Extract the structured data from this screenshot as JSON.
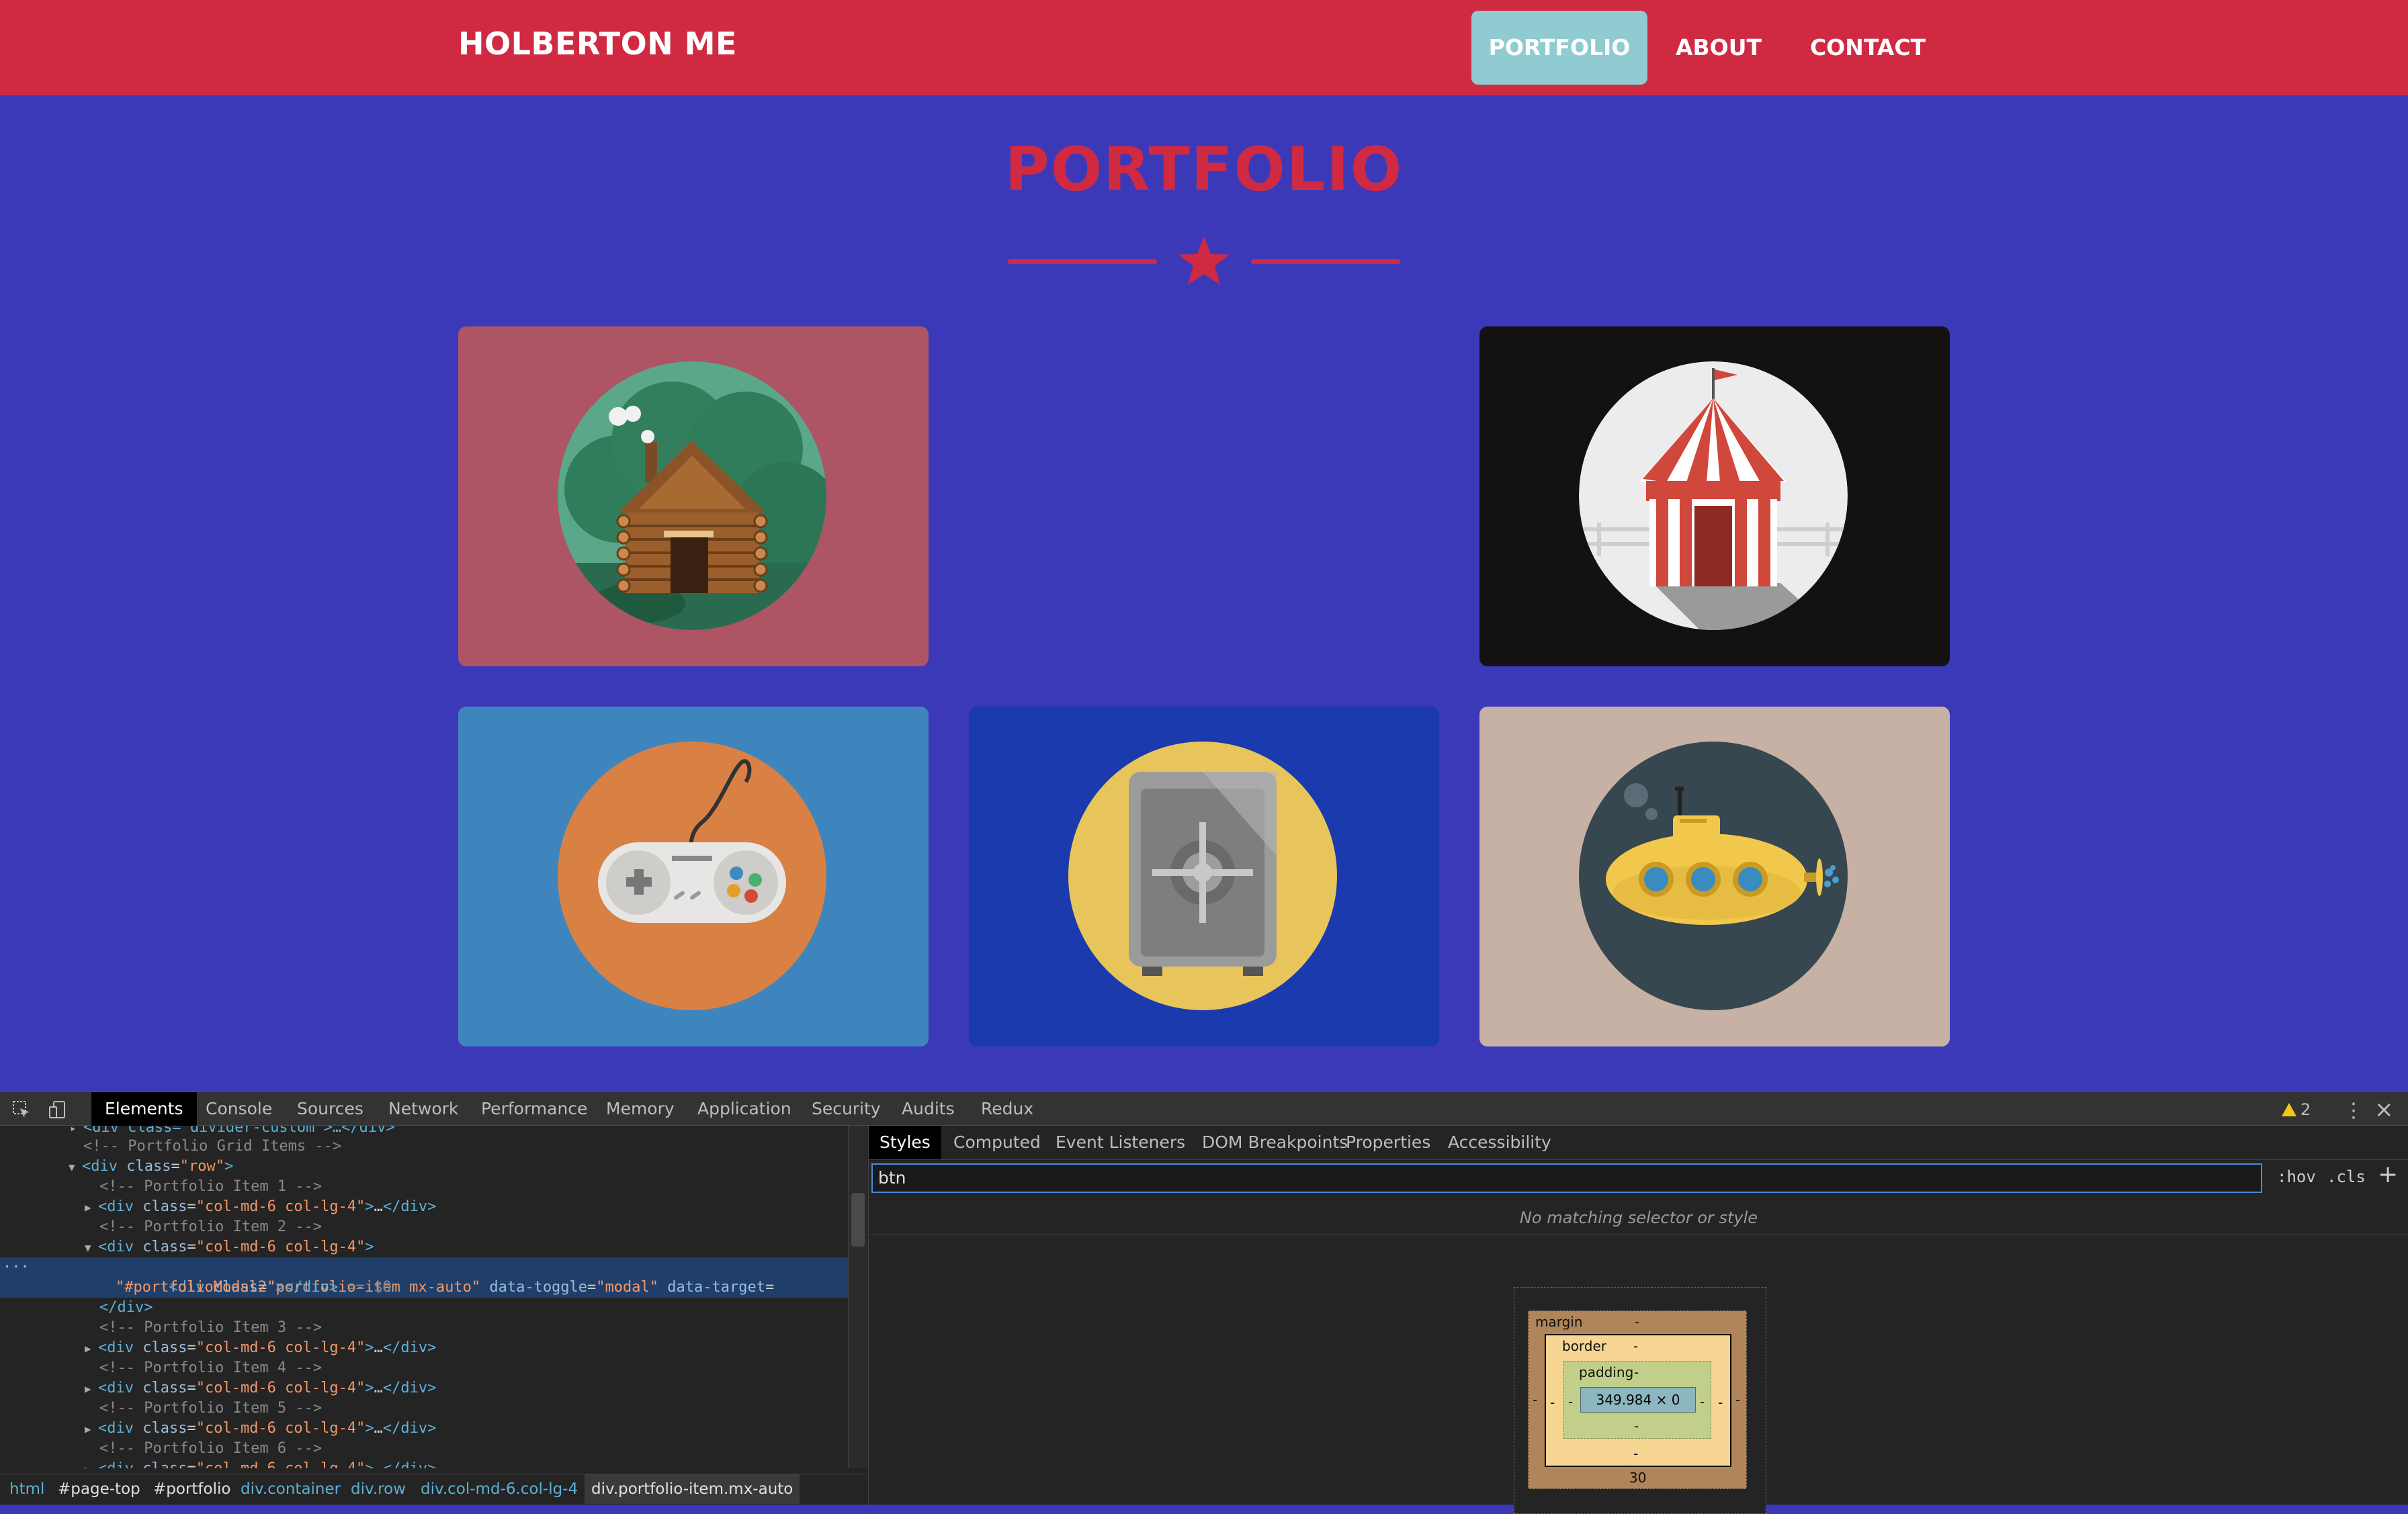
{
  "navbar": {
    "brand": "HOLBERTON ME",
    "links": [
      "PORTFOLIO",
      "ABOUT",
      "CONTACT"
    ],
    "active": "PORTFOLIO"
  },
  "portfolio": {
    "title": "PORTFOLIO",
    "items": [
      {
        "name": "cabin",
        "background": "#ad5565",
        "icon": "log-cabin-icon"
      },
      {
        "name": "empty",
        "background": "none",
        "icon": ""
      },
      {
        "name": "circus",
        "background": "#131210",
        "icon": "circus-tent-icon"
      },
      {
        "name": "game",
        "background": "#3f85bd",
        "icon": "game-controller-icon"
      },
      {
        "name": "safe",
        "background": "#1a3aad",
        "icon": "safe-icon"
      },
      {
        "name": "submarine",
        "background": "#c7b1a5",
        "icon": "submarine-icon"
      }
    ]
  },
  "devtools": {
    "tabs": [
      "Elements",
      "Console",
      "Sources",
      "Network",
      "Performance",
      "Memory",
      "Application",
      "Security",
      "Audits",
      "Redux"
    ],
    "active_tab": "Elements",
    "warning_count": "2",
    "dom": {
      "line0": "<div class=\"divider-custom\">…</div>",
      "comment_grid": "<!-- Portfolio Grid Items -->",
      "row_open_tag": "div",
      "row_attr": "class",
      "row_val": "\"row\"",
      "comment1": "<!-- Portfolio Item 1 -->",
      "comment2": "<!-- Portfolio Item 2 -->",
      "comment3": "<!-- Portfolio Item 3 -->",
      "comment4": "<!-- Portfolio Item 4 -->",
      "comment5": "<!-- Portfolio Item 5 -->",
      "comment6": "<!-- Portfolio Item 6 -->",
      "col_class": "\"col-md-6 col-lg-4\"",
      "ellipsis": "…",
      "selected_class": "\"portfolio-item mx-auto\"",
      "toggle_attr": "data-toggle",
      "toggle_val": "\"modal\"",
      "target_attr": "data-target",
      "target_val": "\"#portfolioModal2\"",
      "selected_marker": "== $0",
      "close_div": "</div>"
    },
    "breadcrumb": [
      "html",
      "#page-top",
      "#portfolio",
      "div.container",
      "div.row",
      "div.col-md-6.col-lg-4",
      "div.portfolio-item.mx-auto"
    ],
    "styles_tabs": [
      "Styles",
      "Computed",
      "Event Listeners",
      "DOM Breakpoints",
      "Properties",
      "Accessibility"
    ],
    "active_styles_tab": "Styles",
    "filter_value": "btn",
    "hov_label": ":hov",
    "cls_label": ".cls",
    "add_label": "+",
    "no_match": "No matching selector or style",
    "box_model": {
      "margin_label": "margin",
      "border_label": "border",
      "padding_label": "padding",
      "dash": "-",
      "content": "349.984 × 0",
      "margin_bottom": "30"
    }
  }
}
